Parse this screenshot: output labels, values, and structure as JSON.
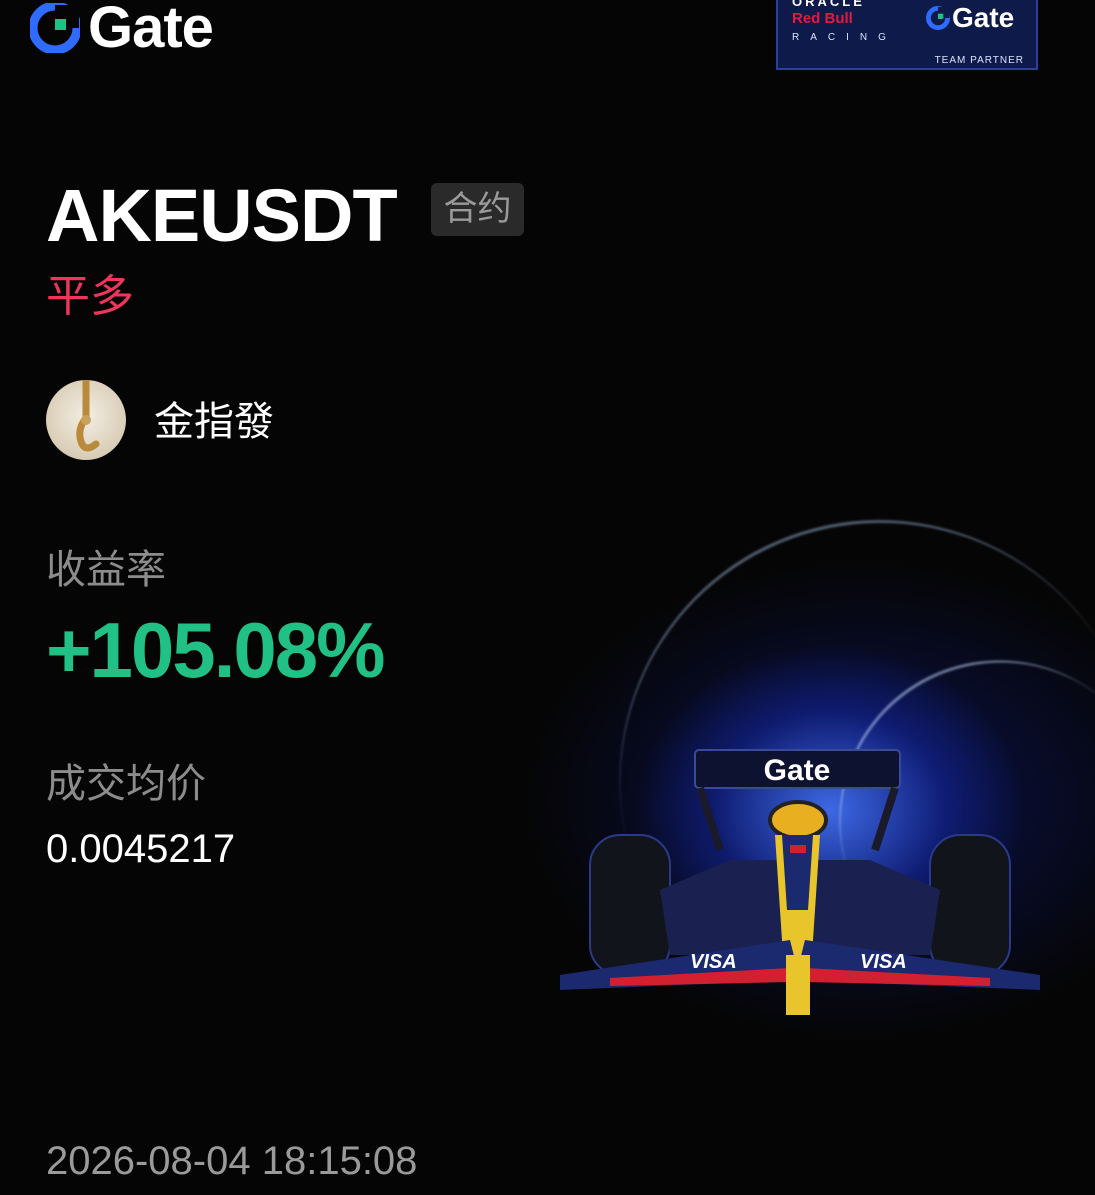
{
  "brand": {
    "name": "Gate"
  },
  "partner_badge": {
    "oracle": "ORACLE",
    "redbull": "Red Bull",
    "racing": "RACING",
    "gate": "Gate",
    "team_partner": "TEAM PARTNER"
  },
  "trade": {
    "pair": "AKEUSDT",
    "type_tag": "合约",
    "side": "平多"
  },
  "user": {
    "name": "金指發"
  },
  "roi": {
    "label": "收益率",
    "value": "+105.08%"
  },
  "avg_price": {
    "label": "成交均价",
    "value": "0.0045217"
  },
  "timestamp": "2026-08-04 18:15:08",
  "car": {
    "wing_text": "Gate",
    "livery": "VISA"
  },
  "colors": {
    "background": "#050505",
    "brand_blue": "#2f6bff",
    "profit_green": "#21c084",
    "side_red": "#f0355b",
    "label_gray": "#8c8c8c"
  }
}
